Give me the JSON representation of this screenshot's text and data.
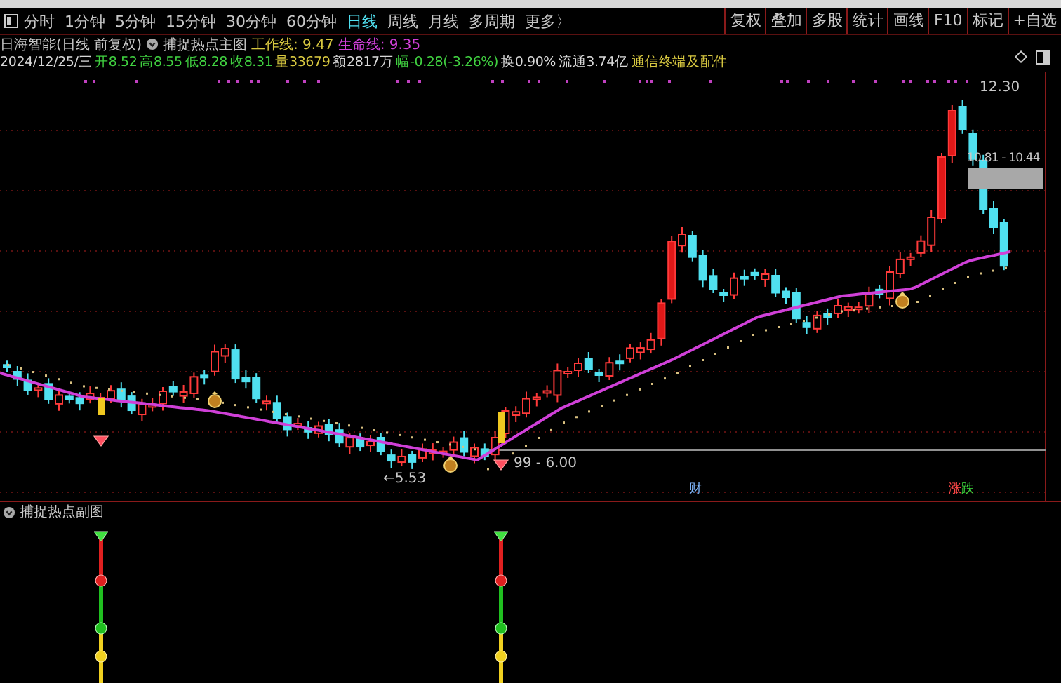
{
  "period_tabs": [
    {
      "label": "分时",
      "selected": false
    },
    {
      "label": "1分钟",
      "selected": false
    },
    {
      "label": "5分钟",
      "selected": false
    },
    {
      "label": "15分钟",
      "selected": false
    },
    {
      "label": "30分钟",
      "selected": false
    },
    {
      "label": "60分钟",
      "selected": false
    },
    {
      "label": "日线",
      "selected": true
    },
    {
      "label": "周线",
      "selected": false
    },
    {
      "label": "月线",
      "selected": false
    },
    {
      "label": "多周期",
      "selected": false
    },
    {
      "label": "更多〉",
      "selected": false
    }
  ],
  "tool_buttons": [
    "复权",
    "叠加",
    "多股",
    "统计",
    "画线",
    "F10",
    "标记",
    "+自选"
  ],
  "main_chart": {
    "stock": "日海智能(日线 前复权)",
    "indicator": "捕捉热点主图",
    "lines": [
      {
        "label": "工作线: 9.47",
        "color": "#d8c840"
      },
      {
        "label": "生命线: 9.35",
        "color": "#d040d8"
      }
    ],
    "quote": [
      {
        "text": "2024/12/25/三",
        "color": "#d8d8d8"
      },
      {
        "text": "开8.52",
        "color": "#40d040"
      },
      {
        "text": "高8.55",
        "color": "#40d040"
      },
      {
        "text": "低8.28",
        "color": "#40d040"
      },
      {
        "text": "收8.31",
        "color": "#40d040"
      },
      {
        "text": "量33679",
        "color": "#d8c840"
      },
      {
        "text": "额2817万",
        "color": "#d8d8d8"
      },
      {
        "text": "幅-0.28(-3.26%)",
        "color": "#40d040"
      },
      {
        "text": "换0.90%",
        "color": "#d8d8d8"
      },
      {
        "text": "流通3.74亿",
        "color": "#d8d8d8"
      },
      {
        "text": "通信终端及配件",
        "color": "#d8c840"
      }
    ],
    "price_labels": [
      "12.30",
      "10.81 - 10.44",
      "←5.53",
      "99 - 6.00"
    ],
    "markers": [
      {
        "label": "财",
        "color": "#80b8ff"
      },
      {
        "label": "涨",
        "color": "#ff4848"
      },
      {
        "label": "跌",
        "color": "#40e040"
      }
    ]
  },
  "sub_chart": {
    "title": "捕捉热点副图"
  }
}
